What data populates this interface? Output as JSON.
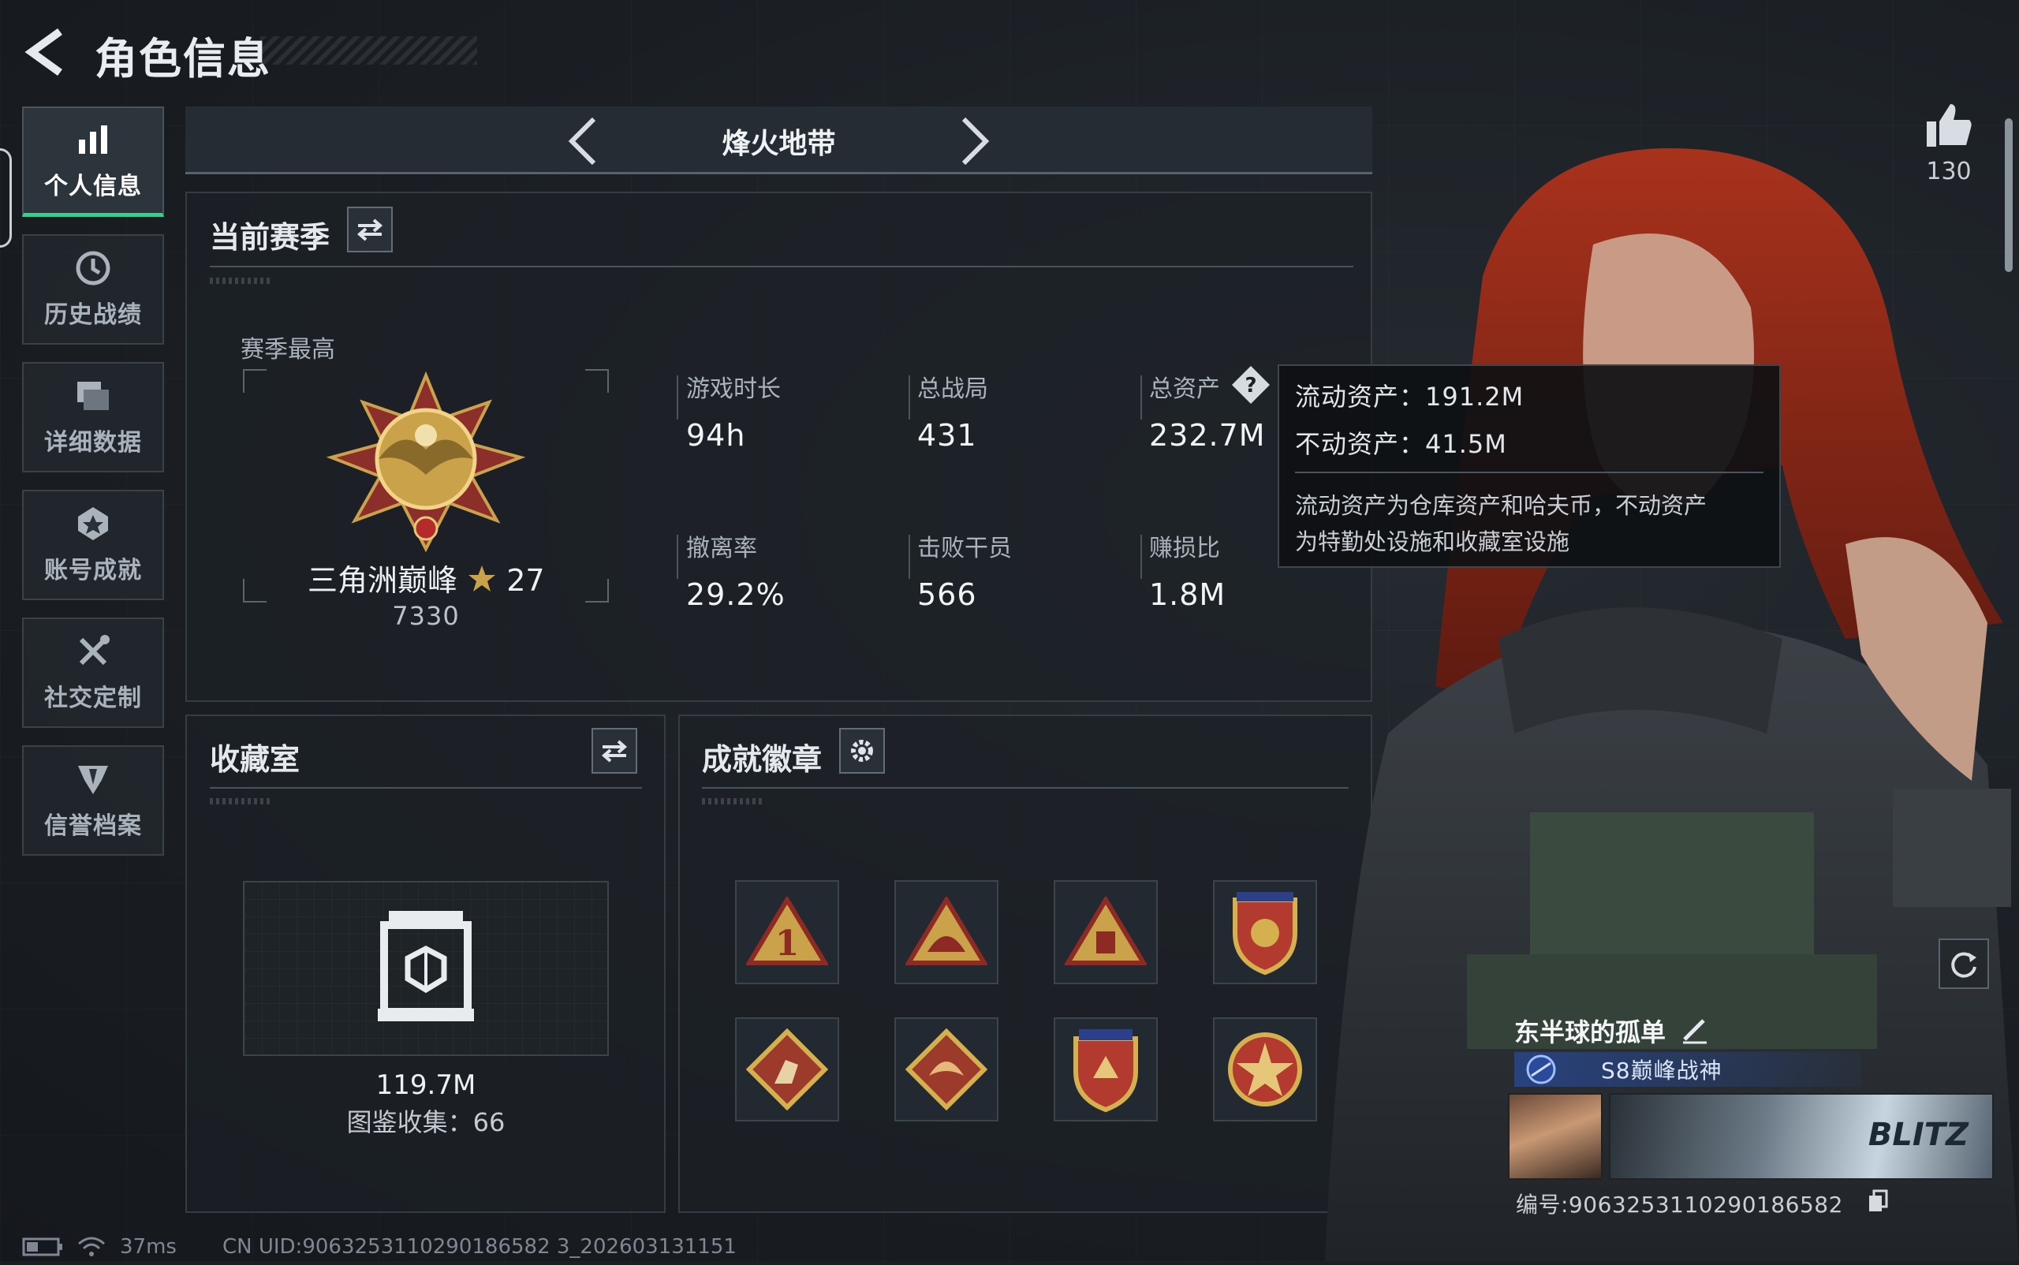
{
  "header": {
    "title": "角色信息"
  },
  "sidebar": {
    "items": [
      {
        "label": "个人信息",
        "icon": "bar-chart-icon",
        "active": true
      },
      {
        "label": "历史战绩",
        "icon": "history-icon"
      },
      {
        "label": "详细数据",
        "icon": "folder-icon"
      },
      {
        "label": "账号成就",
        "icon": "achievement-icon"
      },
      {
        "label": "社交定制",
        "icon": "tools-icon"
      },
      {
        "label": "信誉档案",
        "icon": "credit-icon"
      }
    ]
  },
  "mode": {
    "label": "烽火地带"
  },
  "season": {
    "title": "当前赛季",
    "best_label": "赛季最高",
    "rank_name": "三角洲巅峰",
    "rank_stars": "27",
    "rank_score": "7330",
    "stats": [
      {
        "label": "游戏时长",
        "value": "94h"
      },
      {
        "label": "总战局",
        "value": "431"
      },
      {
        "label": "总资产",
        "value": "232.7M"
      },
      {
        "label": "撤离率",
        "value": "29.2%"
      },
      {
        "label": "击败干员",
        "value": "566"
      },
      {
        "label": "赚损比",
        "value": "1.8M"
      }
    ]
  },
  "tooltip": {
    "liquid": "流动资产：191.2M",
    "fixed": "不动资产：41.5M",
    "desc_line1": "流动资产为仓库资产和哈夫币，不动资产",
    "desc_line2": "为特勤处设施和收藏室设施"
  },
  "collection": {
    "title": "收藏室",
    "value": "119.7M",
    "count": "图鉴收集：66"
  },
  "badges": {
    "title": "成就徽章",
    "items": [
      "badge-1",
      "badge-2",
      "badge-3",
      "badge-4",
      "badge-5",
      "badge-6",
      "badge-7",
      "badge-8"
    ]
  },
  "like": {
    "count": "130"
  },
  "player": {
    "name": "东半球的孤单",
    "title": "S8巅峰战神",
    "banner_text": "BLITZ",
    "id": "编号:9063253110290186582"
  },
  "footer": {
    "ping": "37ms",
    "uid": "CN UID:9063253110290186582 3_202603131151"
  },
  "colors": {
    "accent": "#35d18a",
    "gold": "#c9a24a",
    "tooltip_bg": "#0e1013"
  }
}
